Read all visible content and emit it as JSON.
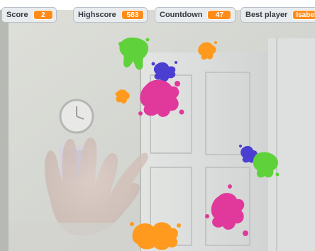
{
  "header": {
    "mark": "."
  },
  "monitors": {
    "score": {
      "label": "Score",
      "value": "2"
    },
    "highscore": {
      "label": "Highscore",
      "value": "583"
    },
    "countdown": {
      "label": "Countdown",
      "value": "47"
    },
    "best_player": {
      "label": "Best player",
      "value": "Isabel"
    }
  },
  "colors": {
    "monitor_value": "#ff8c1a",
    "splat_green": "#5fd13a",
    "splat_blue": "#4a3fd0",
    "splat_orange": "#ff9a1f",
    "splat_pink": "#e0399b"
  },
  "sprites": [
    {
      "name": "green-splat",
      "color": "green"
    },
    {
      "name": "blue-splat",
      "color": "blue"
    },
    {
      "name": "pink-splat",
      "color": "pink"
    },
    {
      "name": "orange-splat",
      "color": "orange"
    }
  ]
}
